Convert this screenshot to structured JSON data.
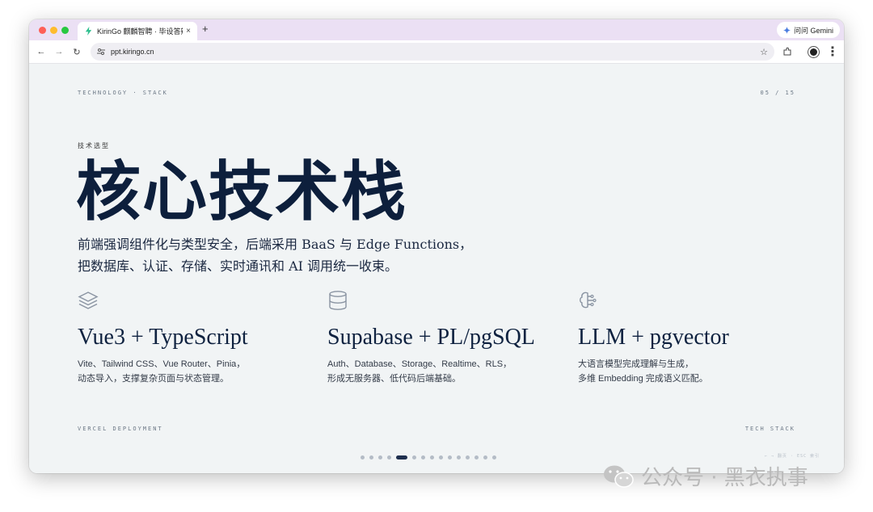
{
  "browser": {
    "tab_title": "KirinGo 麒麟智聘 · 毕设答辩",
    "tab_close": "×",
    "new_tab": "+",
    "gemini_label": "问问 Gemini",
    "url": "ppt.kiringo.cn"
  },
  "slide": {
    "top_left": "TECHNOLOGY · STACK",
    "page_indicator": "05 / 15",
    "kicker": "技术选型",
    "headline": "核心技术栈",
    "subtitle_line1": "前端强调组件化与类型安全，后端采用 BaaS 与 Edge Functions，",
    "subtitle_line2": "把数据库、认证、存储、实时通讯和 AI 调用统一收束。",
    "columns": [
      {
        "icon": "layers-icon",
        "title": "Vue3 + TypeScript",
        "desc_line1": "Vite、Tailwind CSS、Vue Router、Pinia，",
        "desc_line2": "动态导入，支撑复杂页面与状态管理。"
      },
      {
        "icon": "database-icon",
        "title": "Supabase + PL/pgSQL",
        "desc_line1": "Auth、Database、Storage、Realtime、RLS，",
        "desc_line2": "形成无服务器、低代码后端基础。"
      },
      {
        "icon": "brain-icon",
        "title": "LLM + pgvector",
        "desc_line1": "大语言模型完成理解与生成，",
        "desc_line2": "多维 Embedding 完成语义匹配。"
      }
    ],
    "footer_left": "VERCEL DEPLOYMENT",
    "footer_right": "TECH STACK",
    "nav_hint": "← → 翻页 · ESC 索引",
    "pagination": {
      "total": 15,
      "current": 5
    }
  },
  "watermark": {
    "text": "公众号 · 黑衣执事"
  },
  "colors": {
    "tabbar": "#ebe0f4",
    "slide_bg": "#f1f4f5",
    "headline": "#0d1f3c",
    "active_dot": "#1e2f4e"
  }
}
